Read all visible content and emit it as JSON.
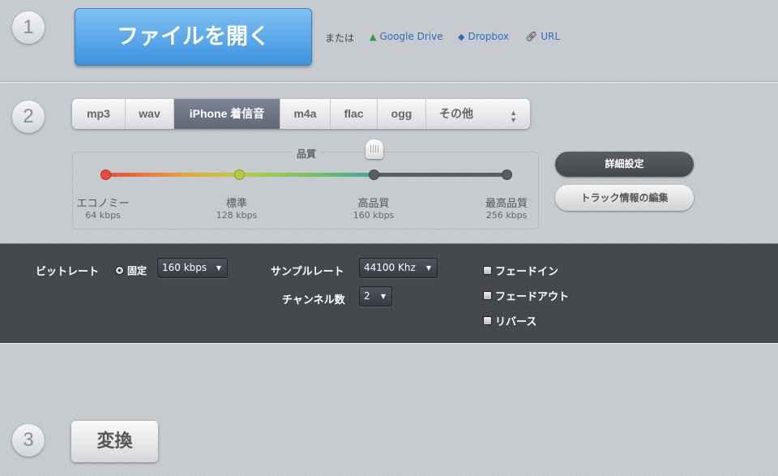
{
  "steps": [
    "1",
    "2",
    "3"
  ],
  "open": {
    "button": "ファイルを開く",
    "or": "または",
    "links": [
      "Google Drive",
      "Dropbox",
      "URL"
    ]
  },
  "formats": {
    "tabs": [
      "mp3",
      "wav",
      "iPhone 着信音",
      "m4a",
      "flac",
      "ogg",
      "その他"
    ],
    "active": "iPhone 着信音"
  },
  "quality": {
    "title": "品質",
    "selected_index": 2,
    "levels": [
      {
        "label": "エコノミー",
        "kbps": "64 kbps"
      },
      {
        "label": "標準",
        "kbps": "128 kbps"
      },
      {
        "label": "高品質",
        "kbps": "160 kbps"
      },
      {
        "label": "最高品質",
        "kbps": "256 kbps"
      }
    ]
  },
  "buttons": {
    "advanced": "詳細設定",
    "track_info": "トラック情報の編集",
    "convert": "変換"
  },
  "advanced": {
    "bitrate_label": "ビットレート",
    "bitrate_mode": "固定",
    "bitrate_value": "160 kbps",
    "samplerate_label": "サンプルレート",
    "samplerate_value": "44100 Khz",
    "channels_label": "チャンネル数",
    "channels_value": "2",
    "checkboxes": [
      {
        "label": "フェードイン",
        "checked": false
      },
      {
        "label": "フェードアウト",
        "checked": false
      },
      {
        "label": "リバース",
        "checked": false
      }
    ]
  }
}
